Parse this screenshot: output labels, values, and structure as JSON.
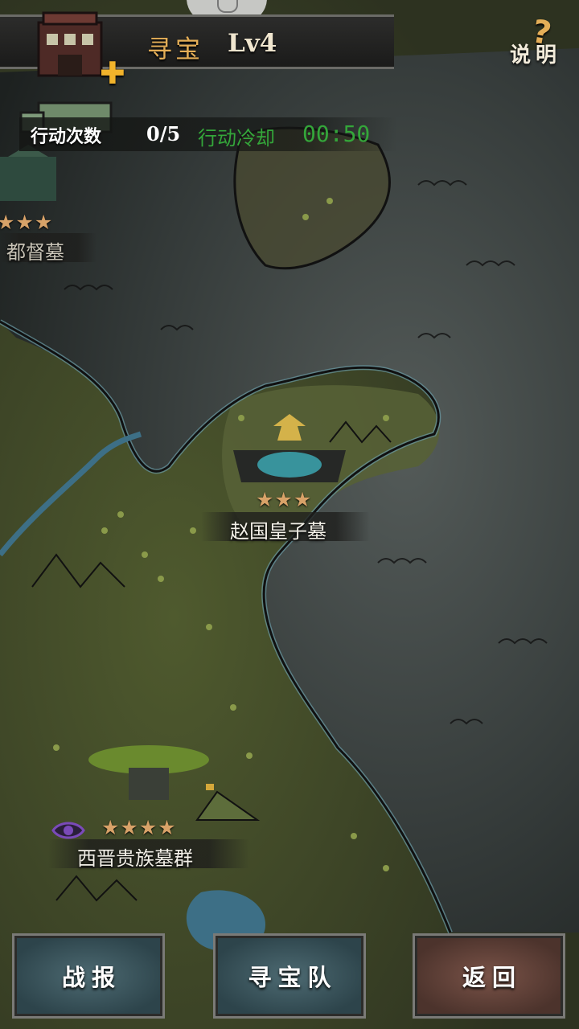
{
  "header": {
    "title": "寻宝",
    "level": "Lv4",
    "help_label": "说明",
    "help_mark": "?"
  },
  "status": {
    "actions_label": "行动次数",
    "actions_count": "0/5",
    "cooldown_label": "行动冷却",
    "cooldown_time": "00:50"
  },
  "tombs": [
    {
      "name": "都督墓",
      "stars": "★★★"
    },
    {
      "name": "赵国皇子墓",
      "stars": "★★★"
    },
    {
      "name": "西晋贵族墓群",
      "stars": "★★★★"
    }
  ],
  "buttons": {
    "report": "战报",
    "team": "寻宝队",
    "back": "返回"
  },
  "colors": {
    "accent_orange": "#e4ae57",
    "cooldown_green": "#34a63a",
    "star": "#d8a268",
    "land": "#4b5232",
    "water": "#3a4140"
  }
}
